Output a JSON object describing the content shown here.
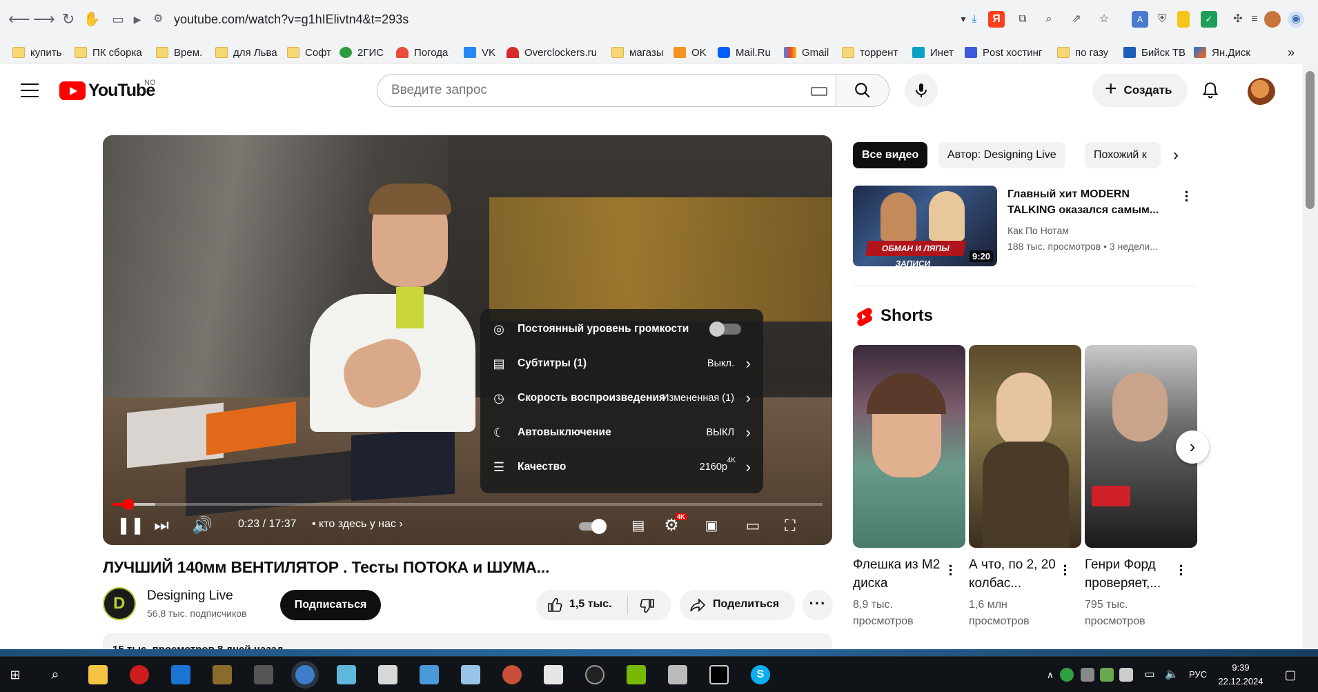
{
  "browser": {
    "url": "youtube.com/watch?v=g1hIElivtn4&t=293s",
    "bookmarks": [
      "купить",
      "ПК сборка",
      "Врем.",
      "для Льва",
      "Софт",
      "2ГИС",
      "Погода",
      "VK",
      "Overclockers.ru",
      "магазы",
      "OK",
      "Mail.Ru",
      "Gmail",
      "торрент",
      "Инет",
      "Post хостинг",
      "по газу",
      "Бийск ТВ",
      "Ян.Диск"
    ],
    "more_bookmarks": "»"
  },
  "header": {
    "logo_text": "YouTube",
    "country_code": "NO",
    "search_placeholder": "Введите запрос",
    "create_label": "Создать"
  },
  "player": {
    "time": "0:23 / 17:37",
    "chapter": "• кто здесь у нас",
    "progress_fraction": 0.022,
    "buffer_fraction": 0.06,
    "settings_badge": "4K",
    "settings_menu": [
      {
        "label": "Постоянный уровень громкости",
        "value": "",
        "icon": "volume-wave-icon"
      },
      {
        "label": "Субтитры (1)",
        "value": "Выкл.",
        "icon": "subtitles-icon"
      },
      {
        "label": "Скорость воспроизведения",
        "value": "Измененная (1)",
        "icon": "playback-speed-icon"
      },
      {
        "label": "Автовыключение",
        "value": "ВЫКЛ",
        "icon": "sleep-timer-icon"
      },
      {
        "label": "Качество",
        "value": "2160p",
        "icon": "quality-sliders-icon"
      }
    ],
    "quality_badge": "4K"
  },
  "video": {
    "title": "ЛУЧШИЙ 140мм ВЕНТИЛЯТОР . Тесты ПОТОКА и ШУМА...",
    "channel": "Designing Live",
    "subscribers": "56,8 тыс. подписчиков",
    "subscribe_label": "Подписаться",
    "likes": "1,5 тыс.",
    "share_label": "Поделиться",
    "description_meta": "15 тыс. просмотров  8 дней назад"
  },
  "sidebar": {
    "chips": [
      "Все видео",
      "Автор: Designing Live",
      "Похожий к"
    ],
    "recommended": {
      "title": "Главный хит MODERN TALKING оказался самым...",
      "channel": "Как По Нотам",
      "meta": "188 тыс. просмотров  • 3 недели...",
      "duration": "9:20",
      "thumb_caption": "ОБМАН И ЛЯПЫ ЗАПИСИ"
    },
    "shorts_title": "Shorts",
    "shorts": [
      {
        "title": "Флешка из M2 диска",
        "views": "8,9 тыс. просмотров"
      },
      {
        "title": "А что, по 2, 20 колбас...",
        "views": "1,6 млн просмотров"
      },
      {
        "title": "Генри Форд проверяет,...",
        "views": "795 тыс. просмотров"
      }
    ]
  },
  "taskbar": {
    "language": "РУС",
    "time": "9:39",
    "date": "22.12.2024"
  },
  "colors": {
    "accent": "#ff0000",
    "chip_active_bg": "#0f0f0f"
  }
}
